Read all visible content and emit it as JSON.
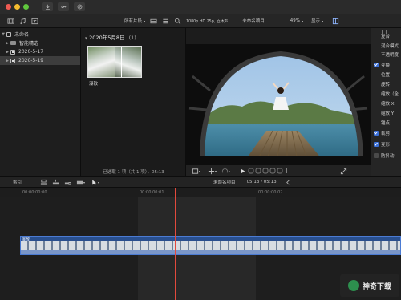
{
  "toolbar": {
    "clip_filter": "所有片段",
    "viewer_format": "1080p HD 25p, 立体声",
    "project_name": "未命名项目",
    "zoom": "49%",
    "display_label": "显示"
  },
  "library": {
    "items": [
      {
        "label": "未命名"
      },
      {
        "label": "智能精选"
      },
      {
        "label": "2020-5-17"
      },
      {
        "label": "2020-5-19"
      }
    ]
  },
  "browser": {
    "date_header": "2020年5月8日",
    "count": "(1)",
    "clip_name": "瀑散",
    "selection_info": "已选取 1 项（共 1 项），05:13"
  },
  "inspector": {
    "sections": [
      {
        "label": "复合",
        "checked": null
      },
      {
        "label": "混合模式",
        "checked": null
      },
      {
        "label": "不透明度",
        "checked": null
      },
      {
        "label": "变换",
        "checked": true
      },
      {
        "label": "位置",
        "checked": null
      },
      {
        "label": "旋转",
        "checked": null
      },
      {
        "label": "缩放（全",
        "checked": null
      },
      {
        "label": "缩放 X",
        "checked": null
      },
      {
        "label": "缩放 Y",
        "checked": null
      },
      {
        "label": "锚点",
        "checked": null
      },
      {
        "label": "裁剪",
        "checked": true
      },
      {
        "label": "变形",
        "checked": true
      },
      {
        "label": "防抖动",
        "checked": false
      }
    ]
  },
  "timeline": {
    "index_label": "索引",
    "project_name": "未命名项目",
    "duration": "05:13 / 05:13",
    "clip_label": "瀑散",
    "ruler_labels": [
      "00:00:00:00",
      "00:00:00:01",
      "00:00:00:02"
    ]
  },
  "watermark": {
    "text": "神奇下载"
  },
  "colors": {
    "accent": "#3a6fd8",
    "playhead": "#e24a3d",
    "clip": "#294f8e"
  }
}
